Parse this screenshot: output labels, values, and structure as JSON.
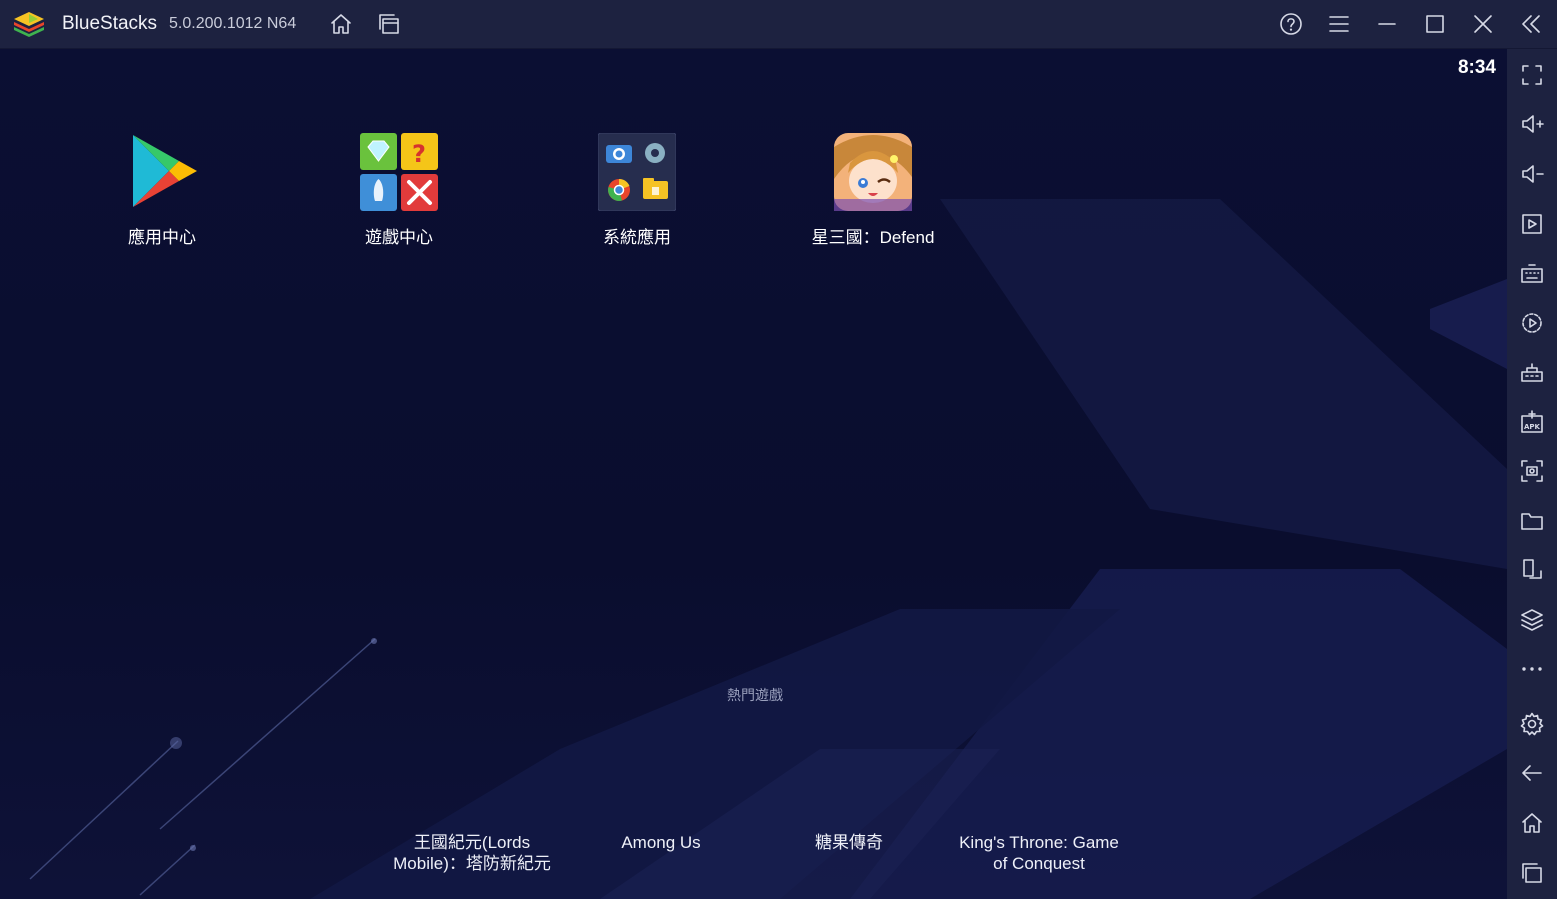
{
  "titlebar": {
    "app_name": "BlueStacks",
    "version": "5.0.200.1012",
    "arch": "N64",
    "buttons": [
      "home-icon",
      "multi-instance-icon",
      "help-icon",
      "menu-icon",
      "minimize-icon",
      "maximize-icon",
      "close-icon",
      "collapse-sidebar-icon"
    ]
  },
  "status": {
    "time": "8:34"
  },
  "apps": [
    {
      "label": "應用中心",
      "icon": "google-play-icon"
    },
    {
      "label": "遊戲中心",
      "icon": "game-center-icon"
    },
    {
      "label": "系統應用",
      "icon": "system-apps-icon"
    },
    {
      "label": "星三國：Defend",
      "icon": "game-avatar-icon"
    }
  ],
  "popular": {
    "title": "熱門遊戲",
    "games": [
      {
        "line1": "王國紀元(Lords",
        "line2": "Mobile)：塔防新紀元"
      },
      {
        "line1": "Among Us",
        "line2": ""
      },
      {
        "line1": "糖果傳奇",
        "line2": ""
      },
      {
        "line1": "King's Throne: Game",
        "line2": "of Conquest"
      }
    ]
  },
  "sidebar": {
    "buttons": [
      "fullscreen-icon",
      "volume-up-icon",
      "volume-down-icon",
      "media-player-icon",
      "keyboard-icon",
      "macro-recorder-icon",
      "multi-instance-sync-icon",
      "install-apk-icon",
      "screenshot-icon",
      "folder-icon",
      "rotate-icon",
      "layers-icon",
      "more-icon",
      "settings-icon",
      "back-icon",
      "home-icon",
      "recent-apps-icon"
    ]
  },
  "colors": {
    "titlebar_bg": "#1d2240",
    "screen_bg": "#0a0e2e",
    "icon_stroke": "#d6d9e6"
  }
}
